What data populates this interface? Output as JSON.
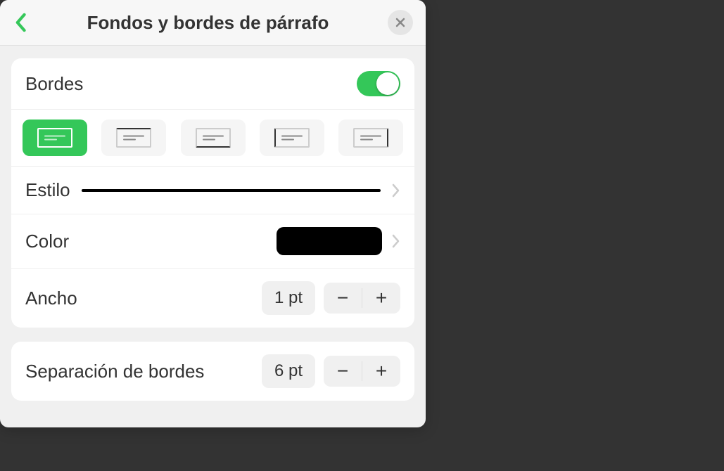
{
  "header": {
    "title": "Fondos y bordes de párrafo"
  },
  "borders": {
    "toggle_label": "Bordes",
    "enabled": true,
    "types": [
      {
        "name": "border-all",
        "selected": true
      },
      {
        "name": "border-top",
        "selected": false
      },
      {
        "name": "border-bottom",
        "selected": false
      },
      {
        "name": "border-left",
        "selected": false
      },
      {
        "name": "border-right",
        "selected": false
      }
    ],
    "style_label": "Estilo",
    "color_label": "Color",
    "color_value": "#000000",
    "width_label": "Ancho",
    "width_value": "1 pt"
  },
  "spacing": {
    "label": "Separación de bordes",
    "value": "6 pt"
  }
}
